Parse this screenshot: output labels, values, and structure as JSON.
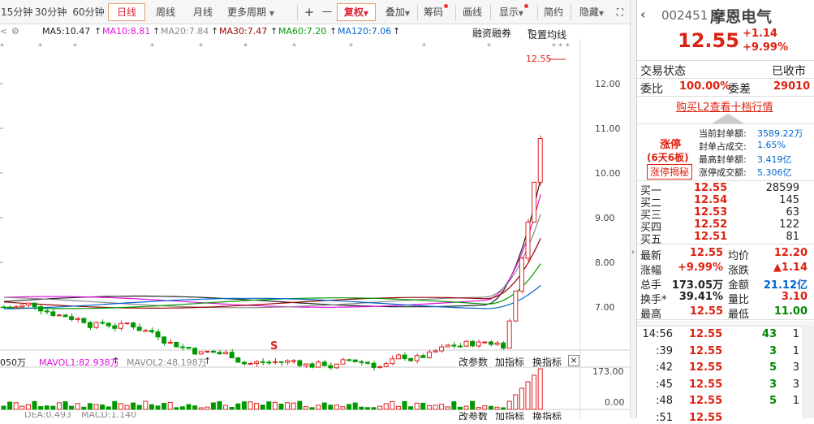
{
  "toolbar": {
    "periods": [
      "15分钟",
      "30分钟",
      "60分钟",
      "日线",
      "周线",
      "月线",
      "更多周期"
    ],
    "plus": "+",
    "minus": "一",
    "fuquan": "复权",
    "diejia": "叠加",
    "chouma": "筹码",
    "huaxian": "画线",
    "xianshi": "显示",
    "jianyue": "简约",
    "yincang": "隐藏",
    "expand": "⛶"
  },
  "ma": {
    "label": "MA",
    "ma5": "MA5:10.47",
    "ma10": "MA10:8.81",
    "ma20": "MA20:7.84",
    "ma30": "MA30:7.47",
    "ma60": "MA60:7.20",
    "ma120": "MA120:7.06",
    "rzrq": "融资融券",
    "setma": "设置均线"
  },
  "price_axis": [
    "12.00",
    "11.00",
    "10.00",
    "9.00",
    "8.00",
    "7.00"
  ],
  "last_price_tag": "12.55",
  "vol": {
    "left": "050万",
    "mavol1": "MAVOL1:82.938万",
    "mavol2": "MAVOL2:48.198万",
    "gaicanshu": "改参数",
    "jiazhibiao": "加指标",
    "huanzhibiao": "换指标",
    "close": "×",
    "axis_top": "173.00",
    "axis_bottom": "0.00"
  },
  "bottom_row": {
    "left": "DEA:0.493",
    "mid": "MACD:1.140",
    "btn1": "改参数",
    "btn2": "加指标",
    "btn3": "换指标"
  },
  "stock": {
    "code": "002451",
    "name": "摩恩电气",
    "price": "12.55",
    "change": "+1.14",
    "pct": "+9.99%"
  },
  "status": {
    "label": "交易状态",
    "value": "已收市"
  },
  "weibi": {
    "label": "委比",
    "value": "100.00%",
    "wc_label": "委差",
    "wc_value": "29010"
  },
  "buy_l2": "购买L2查看十档行情",
  "limit": {
    "title": "涨停",
    "sub": "(6天6板)",
    "btn": "涨停揭秘",
    "rows": [
      {
        "k": "当前封单额:",
        "v": "3589.22万"
      },
      {
        "k": "封单占成交:",
        "v": "1.65%"
      },
      {
        "k": "最高封单额:",
        "v": "3.419亿"
      },
      {
        "k": "涨停成交额:",
        "v": "5.306亿"
      }
    ]
  },
  "bids": [
    {
      "n": "买一",
      "p": "12.55",
      "v": "28599"
    },
    {
      "n": "买二",
      "p": "12.54",
      "v": "145"
    },
    {
      "n": "买三",
      "p": "12.53",
      "v": "63"
    },
    {
      "n": "买四",
      "p": "12.52",
      "v": "122"
    },
    {
      "n": "买五",
      "p": "12.51",
      "v": "81"
    }
  ],
  "stats": [
    {
      "k1": "最新",
      "v1": "12.55",
      "k2": "均价",
      "v2": "12.20"
    },
    {
      "k1": "涨幅",
      "v1": "+9.99%",
      "k2": "涨跌",
      "v2": "▲1.14"
    },
    {
      "k1": "总手",
      "v1": "173.05万",
      "k2": "金额",
      "v2": "21.12亿"
    },
    {
      "k1": "换手*",
      "v1": "39.41%",
      "k2": "量比",
      "v2": "3.10"
    },
    {
      "k1": "最高",
      "v1": "12.55",
      "k2": "最低",
      "v2": "11.00"
    }
  ],
  "ticks": [
    {
      "t": "14:56",
      "p": "12.55",
      "v": "43",
      "n": "1"
    },
    {
      "t": ":39",
      "p": "12.55",
      "v": "3",
      "n": "1"
    },
    {
      "t": ":42",
      "p": "12.55",
      "v": "5",
      "n": "3"
    },
    {
      "t": ":45",
      "p": "12.55",
      "v": "3",
      "n": "3"
    },
    {
      "t": ":48",
      "p": "12.55",
      "v": "5",
      "n": "1"
    },
    {
      "t": ":51",
      "p": "12.55",
      "v": "",
      "n": ""
    }
  ],
  "colors": {
    "up": "#e02020",
    "down": "#009900",
    "ma5": "#222222",
    "ma10": "#e010e0",
    "ma20": "#888888",
    "ma30": "#990000",
    "ma60": "#009900",
    "ma120": "#0066cc"
  }
}
